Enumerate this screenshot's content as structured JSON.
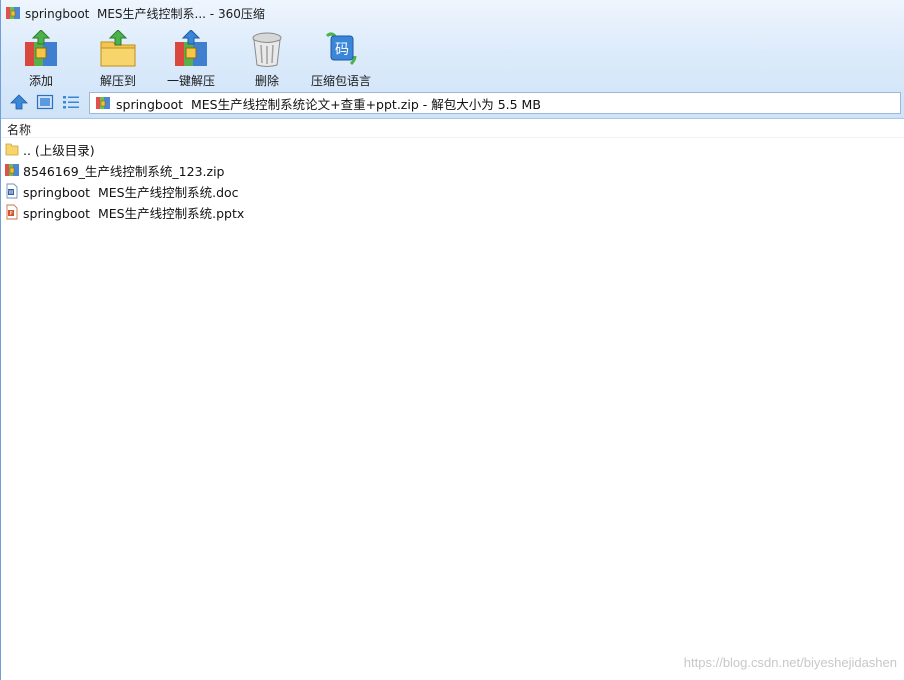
{
  "window": {
    "title": "springboot  MES生产线控制系... - 360压缩"
  },
  "toolbar": {
    "items": [
      {
        "label": "添加",
        "icon": "add-archive-icon"
      },
      {
        "label": "解压到",
        "icon": "extract-to-icon"
      },
      {
        "label": "一键解压",
        "icon": "one-click-extract-icon"
      },
      {
        "label": "删除",
        "icon": "trash-can-icon"
      },
      {
        "label": "压缩包语言",
        "icon": "archive-encoding-icon"
      }
    ],
    "encoding_glyph": "码"
  },
  "addressbar": {
    "path_text": "springboot  MES生产线控制系统论文+查重+ppt.zip - 解包大小为 5.5 MB"
  },
  "list": {
    "column_name": "名称",
    "rows": [
      {
        "label": ".. (上级目录)",
        "icon": "folder-icon"
      },
      {
        "label": "8546169_生产线控制系统_123.zip",
        "icon": "zip-archive-icon"
      },
      {
        "label": "springboot  MES生产线控制系统.doc",
        "icon": "word-document-icon"
      },
      {
        "label": "springboot  MES生产线控制系统.pptx",
        "icon": "powerpoint-document-icon"
      }
    ]
  },
  "watermark": "https://blog.csdn.net/biyeshejidashen",
  "colors": {
    "chrome_top": "#eef5fd",
    "chrome_bottom": "#cfe3f8",
    "accent_blue": "#3a86d8"
  }
}
